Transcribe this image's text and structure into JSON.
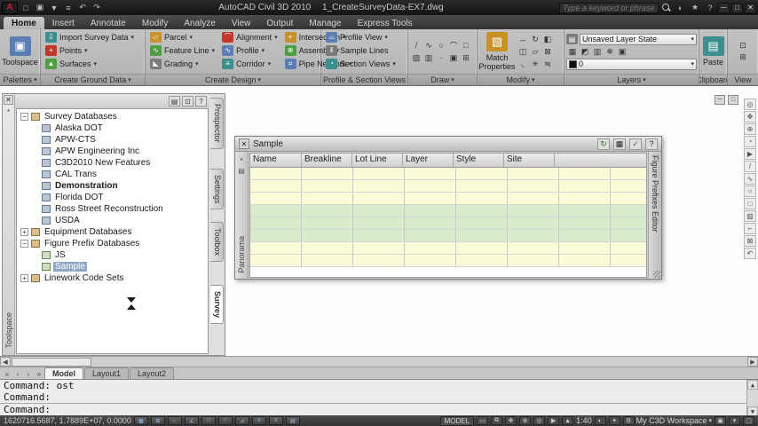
{
  "colors": {
    "titlebar-bg": "#141414",
    "ribbon-bg": "#b3b3b3",
    "canvas-bg": "#fdfdfd",
    "statusbar-bg": "#353535",
    "selection-bg": "#8fa8c8",
    "row-yellow": "#fbfbd8",
    "row-green": "#d8eccc",
    "accent-red": "#c22133"
  },
  "titlebar": {
    "app_title": "AutoCAD Civil 3D 2010",
    "doc_title": "1_CreateSurveyData-EX7.dwg",
    "search": {
      "placeholder": "Type a keyword or phrase"
    }
  },
  "menubar": {
    "tabs": [
      {
        "label": "Home"
      },
      {
        "label": "Insert"
      },
      {
        "label": "Annotate"
      },
      {
        "label": "Modify"
      },
      {
        "label": "Analyze"
      },
      {
        "label": "View"
      },
      {
        "label": "Output"
      },
      {
        "label": "Manage"
      },
      {
        "label": "Express Tools"
      }
    ]
  },
  "ribbon": {
    "palettes": {
      "label": "Palettes",
      "toolspace_label": "Toolspace"
    },
    "ground": {
      "label": "Create Ground Data",
      "items": [
        "Import Survey Data",
        "Points",
        "Surfaces"
      ]
    },
    "design": {
      "label": "Create Design",
      "items": [
        "Parcel",
        "Feature Line",
        "Grading",
        "Alignment",
        "Profile",
        "Corridor",
        "Intersection",
        "Assembly",
        "Pipe Network"
      ]
    },
    "views": {
      "label": "Profile & Section Views",
      "items": [
        "Profile View",
        "Sample Lines",
        "Section Views"
      ]
    },
    "draw": {
      "label": "Draw"
    },
    "modify": {
      "label": "Modify",
      "match_label": "Match Properties"
    },
    "layers": {
      "label": "Layers",
      "layer_state": "Unsaved Layer State",
      "current_layer": "0"
    },
    "clipboard": {
      "label": "Clipboard",
      "paste_label": "Paste"
    },
    "view": {
      "label": "View"
    }
  },
  "toolspace": {
    "title": "Toolspace",
    "tabs": [
      {
        "label": "Prospector"
      },
      {
        "label": "Settings"
      },
      {
        "label": "Toolbox"
      },
      {
        "label": "Survey"
      }
    ],
    "tree": [
      {
        "label": "Survey Databases"
      },
      {
        "label": "Alaska DOT"
      },
      {
        "label": "APW-CTS"
      },
      {
        "label": "APW Engineering Inc"
      },
      {
        "label": "C3D2010 New Features"
      },
      {
        "label": "CAL Trans"
      },
      {
        "label": "Demonstration"
      },
      {
        "label": "Florida DOT"
      },
      {
        "label": "Ross Street Reconstruction"
      },
      {
        "label": "USDA"
      },
      {
        "label": "Equipment Databases"
      },
      {
        "label": "Figure Prefix Databases"
      },
      {
        "label": "JS"
      },
      {
        "label": "Sample"
      },
      {
        "label": "Linework Code Sets"
      }
    ]
  },
  "panorama": {
    "title": "Sample",
    "left_label": "Panorama",
    "right_label": "Figure Prefixes Editor",
    "columns": [
      "Name",
      "Breakline",
      "Lot Line",
      "Layer",
      "Style",
      "Site"
    ]
  },
  "layout_tabs": {
    "tabs": [
      {
        "label": "Model"
      },
      {
        "label": "Layout1"
      },
      {
        "label": "Layout2"
      }
    ]
  },
  "command": {
    "line1": "Command: ost",
    "line2": "Command:",
    "prompt": "Command:"
  },
  "statusbar": {
    "coords": "1620716.5687, 1.7889E+07, 0.0000",
    "model_label": "MODEL",
    "annotation_scale": "1:40",
    "workspace_label": "My C3D Workspace"
  }
}
